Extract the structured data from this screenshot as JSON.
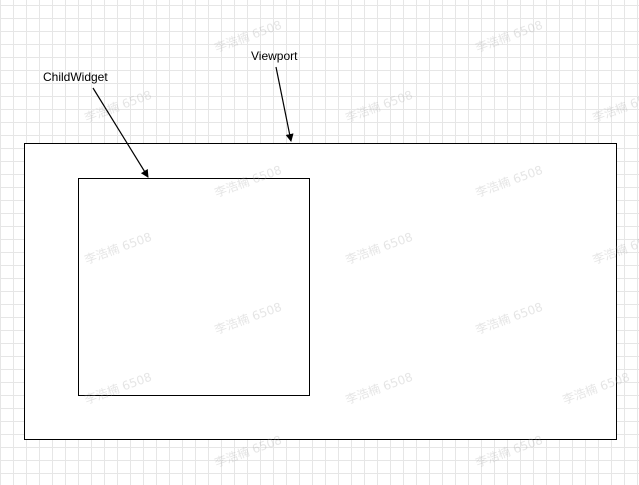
{
  "diagram": {
    "viewport_label": "Viewport",
    "child_label": "ChildWidget"
  },
  "watermark": {
    "text": "李浩楠 6508"
  }
}
